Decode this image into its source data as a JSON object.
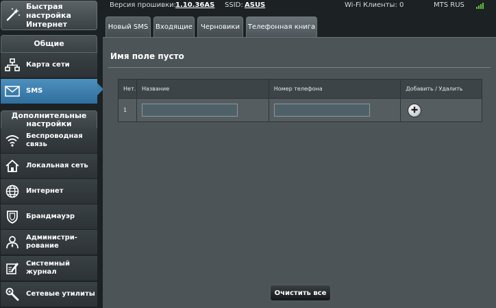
{
  "sidebar": {
    "quick_setup": "Быстрая настройка Интернет",
    "general_header": "Общие",
    "general_items": [
      {
        "label": "Карта сети",
        "icon": "network-map-icon"
      },
      {
        "label": "SMS",
        "icon": "sms-envelope-icon"
      }
    ],
    "advanced_header": "Дополнительные настройки",
    "advanced_items": [
      {
        "label": "Беспроводная связь",
        "icon": "wireless-icon"
      },
      {
        "label": "Локальная сеть",
        "icon": "home-lan-icon"
      },
      {
        "label": "Интернет",
        "icon": "globe-icon"
      },
      {
        "label": "Брандмауэр",
        "icon": "shield-icon"
      },
      {
        "label": "Администри-рование",
        "icon": "admin-user-icon"
      },
      {
        "label": "Системный журнал",
        "icon": "log-icon"
      },
      {
        "label": "Сетевые утилиты",
        "icon": "tools-icon"
      }
    ]
  },
  "topbar": {
    "firmware_label": "Версия прошивки:",
    "firmware_value": "1.10.36AS",
    "ssid_label": "SSID:",
    "ssid_value": "ASUS",
    "wifi_clients": "Wi-Fi Клиенты: 0",
    "operator": "MTS RUS"
  },
  "tabs": [
    {
      "label": "Новый SMS",
      "active": false
    },
    {
      "label": "Входящие",
      "active": false
    },
    {
      "label": "Черновики",
      "active": false
    },
    {
      "label": "Телефонная книга",
      "active": true
    }
  ],
  "main": {
    "title": "Имя поле пусто",
    "table": {
      "headers": [
        "Нет.",
        "Название",
        "Номер телефона",
        "Добавить / Удалить"
      ],
      "row": {
        "index": "1",
        "name_value": "",
        "phone_value": ""
      }
    },
    "clear_all": "Очистить все"
  },
  "colors": {
    "accent_active": "#3d7eae",
    "panel_bg": "#4d5458",
    "signal": "#67c23a"
  }
}
